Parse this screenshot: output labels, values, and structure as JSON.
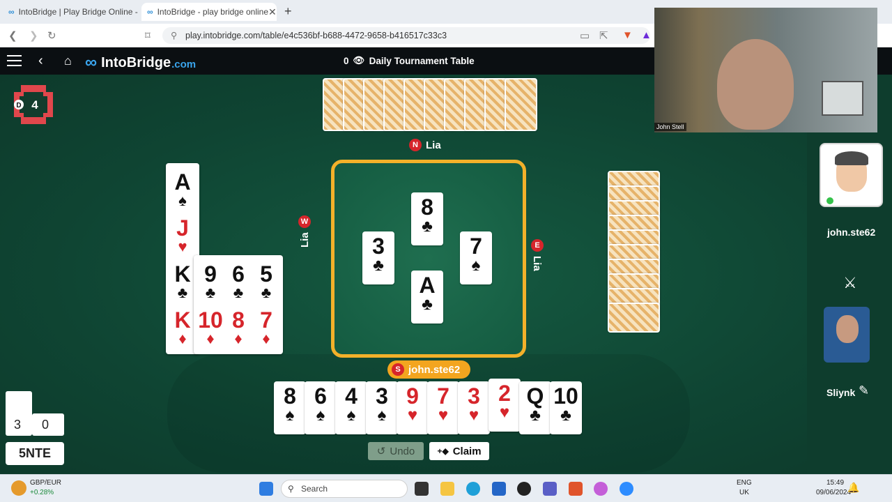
{
  "browser": {
    "tabs": [
      {
        "title": "IntoBridge | Play Bridge Online - For",
        "active": false
      },
      {
        "title": "IntoBridge - play bridge online",
        "active": true
      }
    ],
    "url": "play.intobridge.com/table/e4c536bf-b688-4472-9658-b416517c33c3"
  },
  "header": {
    "brand": "IntoBridge",
    "brand_suffix": ".com",
    "spectators": "0",
    "table_title": "Daily Tournament Table"
  },
  "info": {
    "dealer_badge": "D",
    "board_number": "4",
    "tricks_ns": "3",
    "tricks_ew": "0",
    "contract": "5NTE"
  },
  "seats": {
    "north": {
      "badge": "N",
      "name": "Lia"
    },
    "west": {
      "badge": "W",
      "name": "Lia"
    },
    "east": {
      "badge": "E",
      "name": "Lia"
    },
    "south": {
      "badge": "S",
      "name": "john.ste62"
    }
  },
  "trick": {
    "north": {
      "rank": "8",
      "suit": "♣",
      "color": "#111111"
    },
    "west": {
      "rank": "3",
      "suit": "♣",
      "color": "#111111"
    },
    "east": {
      "rank": "7",
      "suit": "♠",
      "color": "#111111"
    },
    "south": {
      "rank": "A",
      "suit": "♣",
      "color": "#111111"
    }
  },
  "dummy": {
    "spades": [
      "A"
    ],
    "hearts": [
      "J"
    ],
    "clubs": [
      "K",
      "9",
      "6",
      "5"
    ],
    "diamonds": [
      "K",
      "10",
      "8",
      "7"
    ]
  },
  "south_hand": [
    {
      "rank": "8",
      "suit": "♠",
      "color": "#111111"
    },
    {
      "rank": "6",
      "suit": "♠",
      "color": "#111111"
    },
    {
      "rank": "4",
      "suit": "♠",
      "color": "#111111"
    },
    {
      "rank": "3",
      "suit": "♠",
      "color": "#111111"
    },
    {
      "rank": "9",
      "suit": "♥",
      "color": "#d6252b"
    },
    {
      "rank": "7",
      "suit": "♥",
      "color": "#d6252b"
    },
    {
      "rank": "3",
      "suit": "♥",
      "color": "#d6252b"
    },
    {
      "rank": "2",
      "suit": "♥",
      "color": "#d6252b"
    },
    {
      "rank": "Q",
      "suit": "♣",
      "color": "#111111"
    },
    {
      "rank": "10",
      "suit": "♣",
      "color": "#111111"
    }
  ],
  "north_hidden_count": 10,
  "east_hidden_count": 10,
  "buttons": {
    "undo": "Undo",
    "claim": "Claim"
  },
  "side_panel": {
    "player1": "john.ste62",
    "player2": "Sliynk",
    "video_caption": "John Stell"
  },
  "taskbar": {
    "currency": "GBP/EUR",
    "change": "+0.28%",
    "search_placeholder": "Search",
    "lang": "ENG",
    "region": "UK",
    "time": "15:49",
    "date": "09/06/2024"
  }
}
